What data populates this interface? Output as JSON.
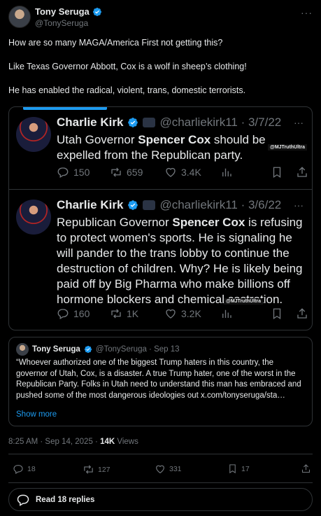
{
  "author": {
    "name": "Tony Seruga",
    "handle": "@TonySeruga"
  },
  "tweet": {
    "lines": [
      "How are so many MAGA/America First not getting this?",
      "Like Texas Governor Abbott, Cox is a wolf in sheep’s clothing!",
      "He has enabled the radical, violent, trans, domestic terrorists."
    ]
  },
  "image": {
    "tweet1": {
      "name": "Charlie Kirk",
      "handle_date": "@charliekirk11 · 3/7/22",
      "text_pre": "Utah Governor ",
      "text_bold": "Spencer Cox",
      "text_post": " should be expelled from the Republican party.",
      "watermark": "@MJTruthUltra",
      "replies": "150",
      "reposts": "659",
      "likes": "3.4K"
    },
    "tweet2": {
      "name": "Charlie Kirk",
      "handle_date": "@charliekirk11 · 3/6/22",
      "text_pre": "Republican Governor ",
      "text_bold": "Spencer Cox",
      "text_post": " is refusing to protect women's sports. He is signaling he will pander to the trans lobby to continue the destruction of children. Why? He is likely being paid off by Big Pharma who make billions off hormone blockers and chemical castration.",
      "watermark": "@MJTruthUltra",
      "replies": "160",
      "reposts": "1K",
      "likes": "3.2K"
    }
  },
  "quote": {
    "name": "Tony Seruga",
    "handle_date": "@TonySeruga · Sep 13",
    "text": "“Whoever authorized one of the biggest Trump haters in this country, the governor of Utah, Cox, is a disaster. A true Trump hater, one of the worst in the Republican Party. Folks in Utah need to understand this man has embraced and pushed some of the most dangerous ideologies out x.com/tonyseruga/sta…",
    "show_more": "Show more"
  },
  "meta": {
    "time": "8:25 AM · Sep 14, 2025 · ",
    "views_count": "14K",
    "views_label": " Views"
  },
  "stats": {
    "replies": "18",
    "reposts": "127",
    "likes": "331",
    "bookmarks": "17"
  },
  "read_replies": "Read 18 replies",
  "colors": {
    "background": "#000000",
    "accent": "#1d9bf0",
    "muted": "#71767b",
    "border": "#2f3336"
  }
}
